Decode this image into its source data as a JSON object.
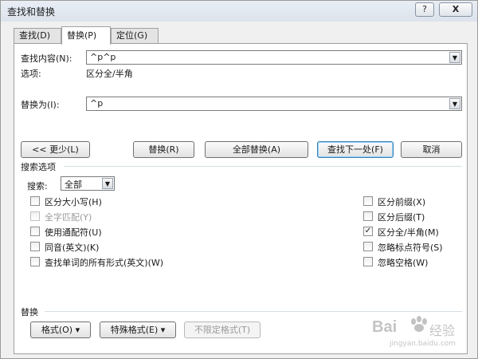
{
  "window": {
    "title": "查找和替换",
    "help_label": "?",
    "close_label": "X"
  },
  "tabs": [
    {
      "label": "查找(D)"
    },
    {
      "label": "替换(P)"
    },
    {
      "label": "定位(G)"
    }
  ],
  "find": {
    "label": "查找内容(N):",
    "value": "^p^p",
    "options_label": "选项:",
    "options_value": "区分全/半角"
  },
  "replace": {
    "label": "替换为(I):",
    "value": "^p"
  },
  "buttons": {
    "less": "<< 更少(L)",
    "replace": "替换(R)",
    "replace_all": "全部替换(A)",
    "find_next": "查找下一处(F)",
    "cancel": "取消"
  },
  "search_options": {
    "section_label": "搜索选项",
    "search_label": "搜索:",
    "search_value": "全部",
    "left": [
      {
        "label": "区分大小写(H)",
        "checked": false,
        "disabled": false
      },
      {
        "label": "全字匹配(Y)",
        "checked": false,
        "disabled": true
      },
      {
        "label": "使用通配符(U)",
        "checked": false,
        "disabled": false
      },
      {
        "label": "同音(英文)(K)",
        "checked": false,
        "disabled": false
      },
      {
        "label": "查找单词的所有形式(英文)(W)",
        "checked": false,
        "disabled": false
      }
    ],
    "right": [
      {
        "label": "区分前缀(X)",
        "checked": false
      },
      {
        "label": "区分后缀(T)",
        "checked": false
      },
      {
        "label": "区分全/半角(M)",
        "checked": true
      },
      {
        "label": "忽略标点符号(S)",
        "checked": false
      },
      {
        "label": "忽略空格(W)",
        "checked": false
      }
    ]
  },
  "replace_section": {
    "label": "替换",
    "format": "格式(O) ▾",
    "special": "特殊格式(E) ▾",
    "no_format": "不限定格式(T)"
  },
  "watermark": {
    "brand": "Bai",
    "brand_suffix": "经验",
    "url": "jingyan.baidu.com"
  }
}
